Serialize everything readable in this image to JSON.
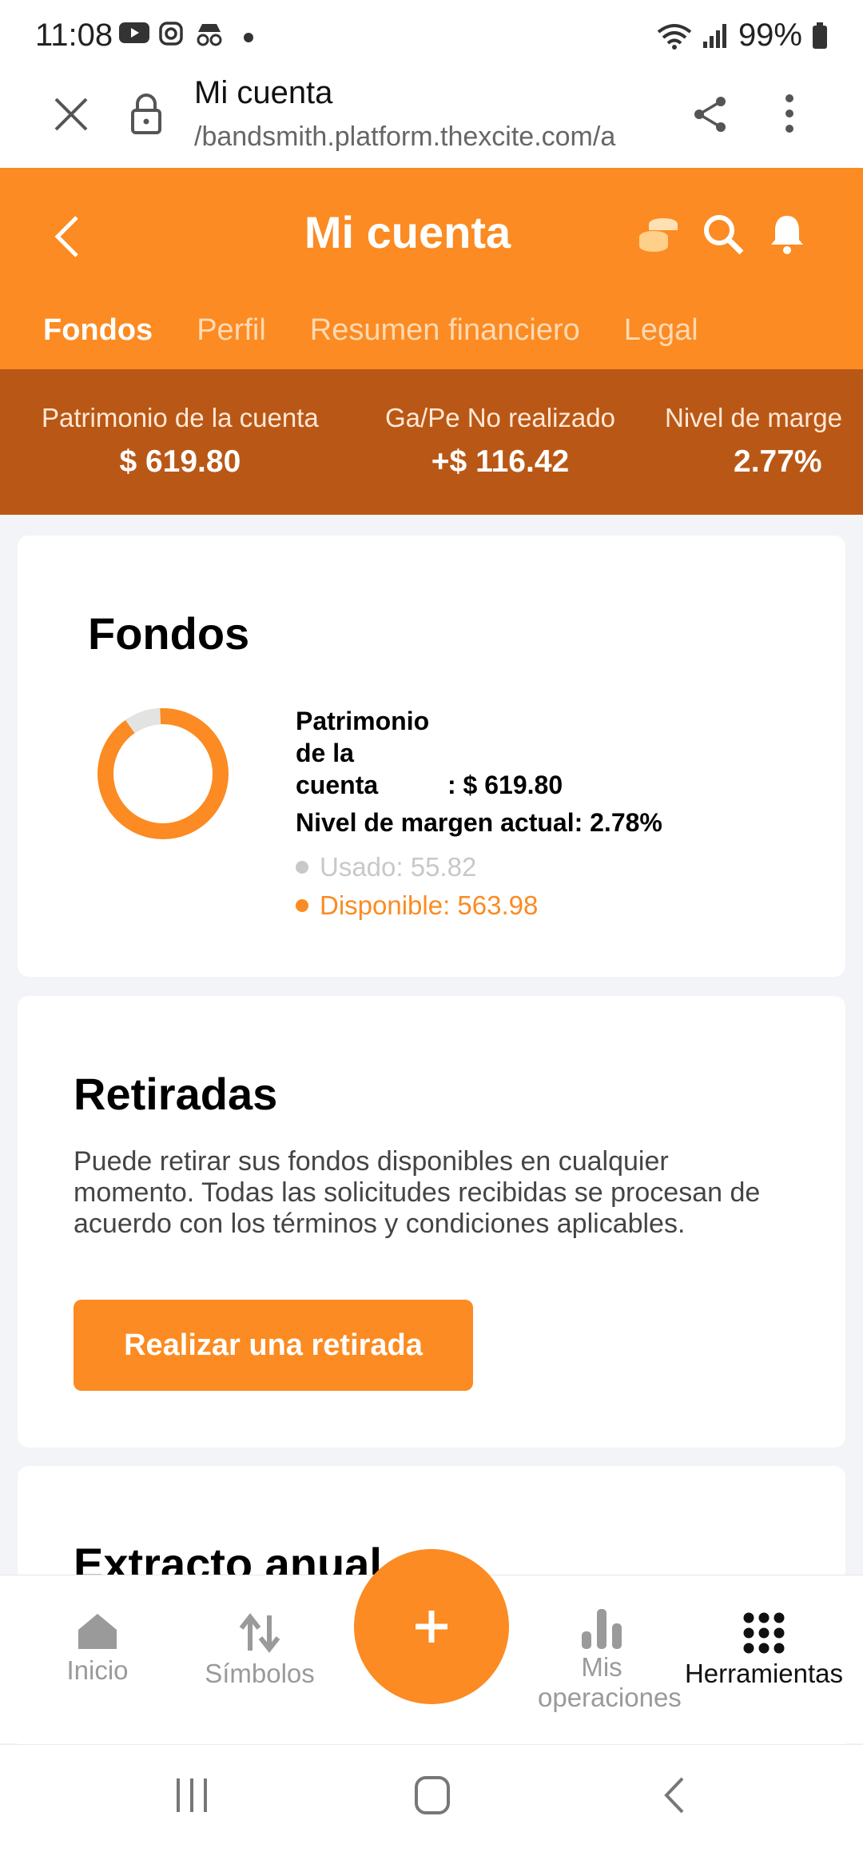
{
  "status_bar": {
    "time": "11:08",
    "battery": "99%"
  },
  "browser": {
    "title": "Mi cuenta",
    "url": "/bandsmith.platform.thexcite.com/a"
  },
  "header": {
    "title": "Mi cuenta",
    "tabs": [
      {
        "label": "Fondos",
        "active": true
      },
      {
        "label": "Perfil"
      },
      {
        "label": "Resumen financiero"
      },
      {
        "label": "Legal"
      }
    ]
  },
  "summary": [
    {
      "label": "Patrimonio de la cuenta",
      "value": "$ 619.80"
    },
    {
      "label": "Ga/Pe No realizado",
      "value": "+$ 116.42"
    },
    {
      "label": "Nivel de marge",
      "value": "2.77%"
    }
  ],
  "fondos": {
    "title": "Fondos",
    "equity_label_1": "Patrimonio",
    "equity_label_2": "de la",
    "equity_label_3": "cuenta",
    "equity_value": ": $ 619.80",
    "margin_label": "Nivel de margen actual: 2.78%",
    "used_label": "Usado: 55.82",
    "available_label": "Disponible: 563.98",
    "used_fraction": 0.09,
    "colors": {
      "used": "#e3e3e3",
      "available": "#fb8b22"
    }
  },
  "retiradas": {
    "title": "Retiradas",
    "text": "Puede retirar sus fondos disponibles en cualquier momento. Todas las solicitudes recibidas se procesan de acuerdo con los términos y condiciones aplicables.",
    "button": "Realizar una retirada"
  },
  "extracto": {
    "title": "Extracto anual"
  },
  "bottom_nav": [
    {
      "label": "Inicio",
      "icon": "home-icon"
    },
    {
      "label": "Símbolos",
      "icon": "swap-arrows-icon"
    },
    {
      "label": "Mis operaciones",
      "icon": "bar-chart-icon"
    },
    {
      "label": "Herramientas",
      "icon": "grid-dots-icon"
    }
  ],
  "accent_color": "#fb8b22"
}
